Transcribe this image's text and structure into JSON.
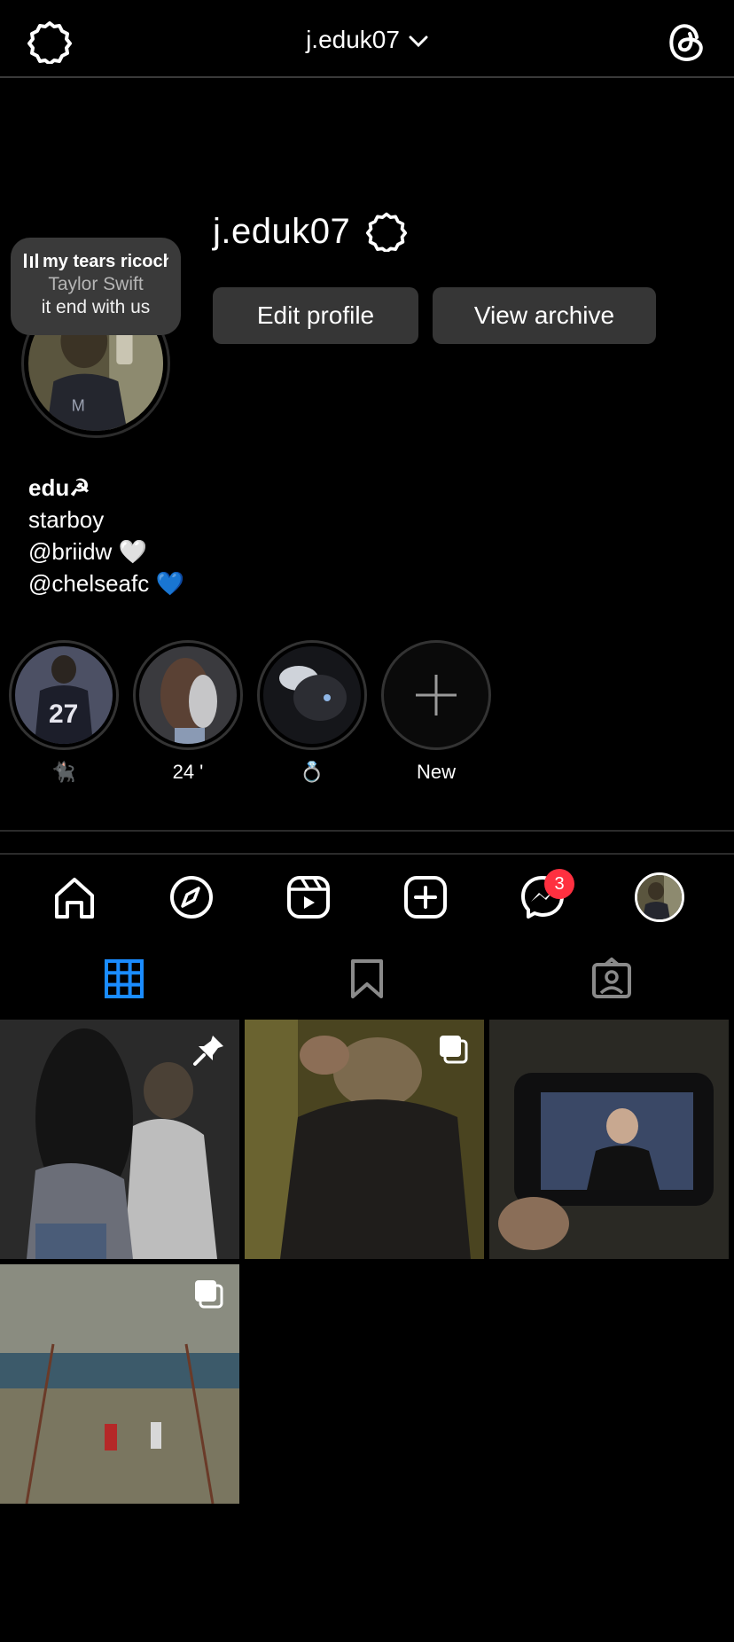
{
  "header": {
    "username": "j.eduk07",
    "chevron_icon": "chevron-down-icon",
    "settings_icon": "settings-gear-icon",
    "threads_icon": "threads-icon"
  },
  "profile": {
    "username": "j.eduk07",
    "edit_label": "Edit profile",
    "archive_label": "View archive"
  },
  "note": {
    "song": "my tears ricochet",
    "artist": "Taylor Swift",
    "text": "it end with us"
  },
  "bio": {
    "name": "edu☭",
    "lines": [
      "starboy",
      "@briidw 🤍",
      "@chelseafc 💙"
    ]
  },
  "highlights": [
    {
      "label": "🐈‍⬛"
    },
    {
      "label": "24 '"
    },
    {
      "label": "💍"
    },
    {
      "label": "New"
    }
  ],
  "nav": {
    "messages_badge": "3"
  },
  "colors": {
    "background": "#000000",
    "button": "#363636",
    "badge": "#ff3040",
    "grid_tab_active": "#1a8cff"
  }
}
